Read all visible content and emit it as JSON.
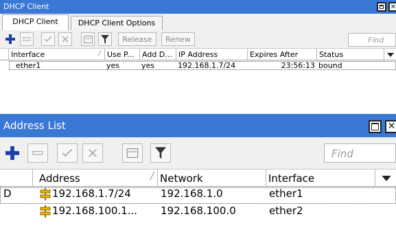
{
  "dhcp_window": {
    "title": "DHCP Client",
    "close_glyph": "✕",
    "tabs": [
      {
        "label": "DHCP Client",
        "active": true
      },
      {
        "label": "DHCP Client Options",
        "active": false
      }
    ],
    "toolbar": {
      "add_icon": "plus-icon",
      "remove_icon": "minus-icon",
      "enable_icon": "check-icon",
      "disable_icon": "x-icon",
      "comment_icon": "comment-icon",
      "filter_icon": "filter-icon",
      "release_label": "Release",
      "renew_label": "Renew",
      "find_placeholder": "Find"
    },
    "columns": [
      "Interface",
      "Use P...",
      "Add D...",
      "IP Address",
      "Expires After",
      "Status"
    ],
    "sort_marker": "/",
    "rows": [
      {
        "interface": "ether1",
        "use_peer": "yes",
        "add_default": "yes",
        "ip_address": "192.168.1.7/24",
        "expires_after": "23:56:13",
        "status": "bound"
      }
    ]
  },
  "address_window": {
    "title": "Address List",
    "close_glyph": "✕",
    "toolbar": {
      "find_placeholder": "Find"
    },
    "columns": [
      "Address",
      "Network",
      "Interface"
    ],
    "sort_marker": "/",
    "rows": [
      {
        "flag": "D",
        "address": "192.168.1.7/24",
        "network": "192.168.1.0",
        "interface": "ether1"
      },
      {
        "flag": "",
        "address": "192.168.100.1...",
        "network": "192.168.100.0",
        "interface": "ether2"
      }
    ]
  },
  "colors": {
    "titlebar": "#3a78d6",
    "add_icon": "#1b3fa8",
    "address_icon": "#e4b400"
  }
}
